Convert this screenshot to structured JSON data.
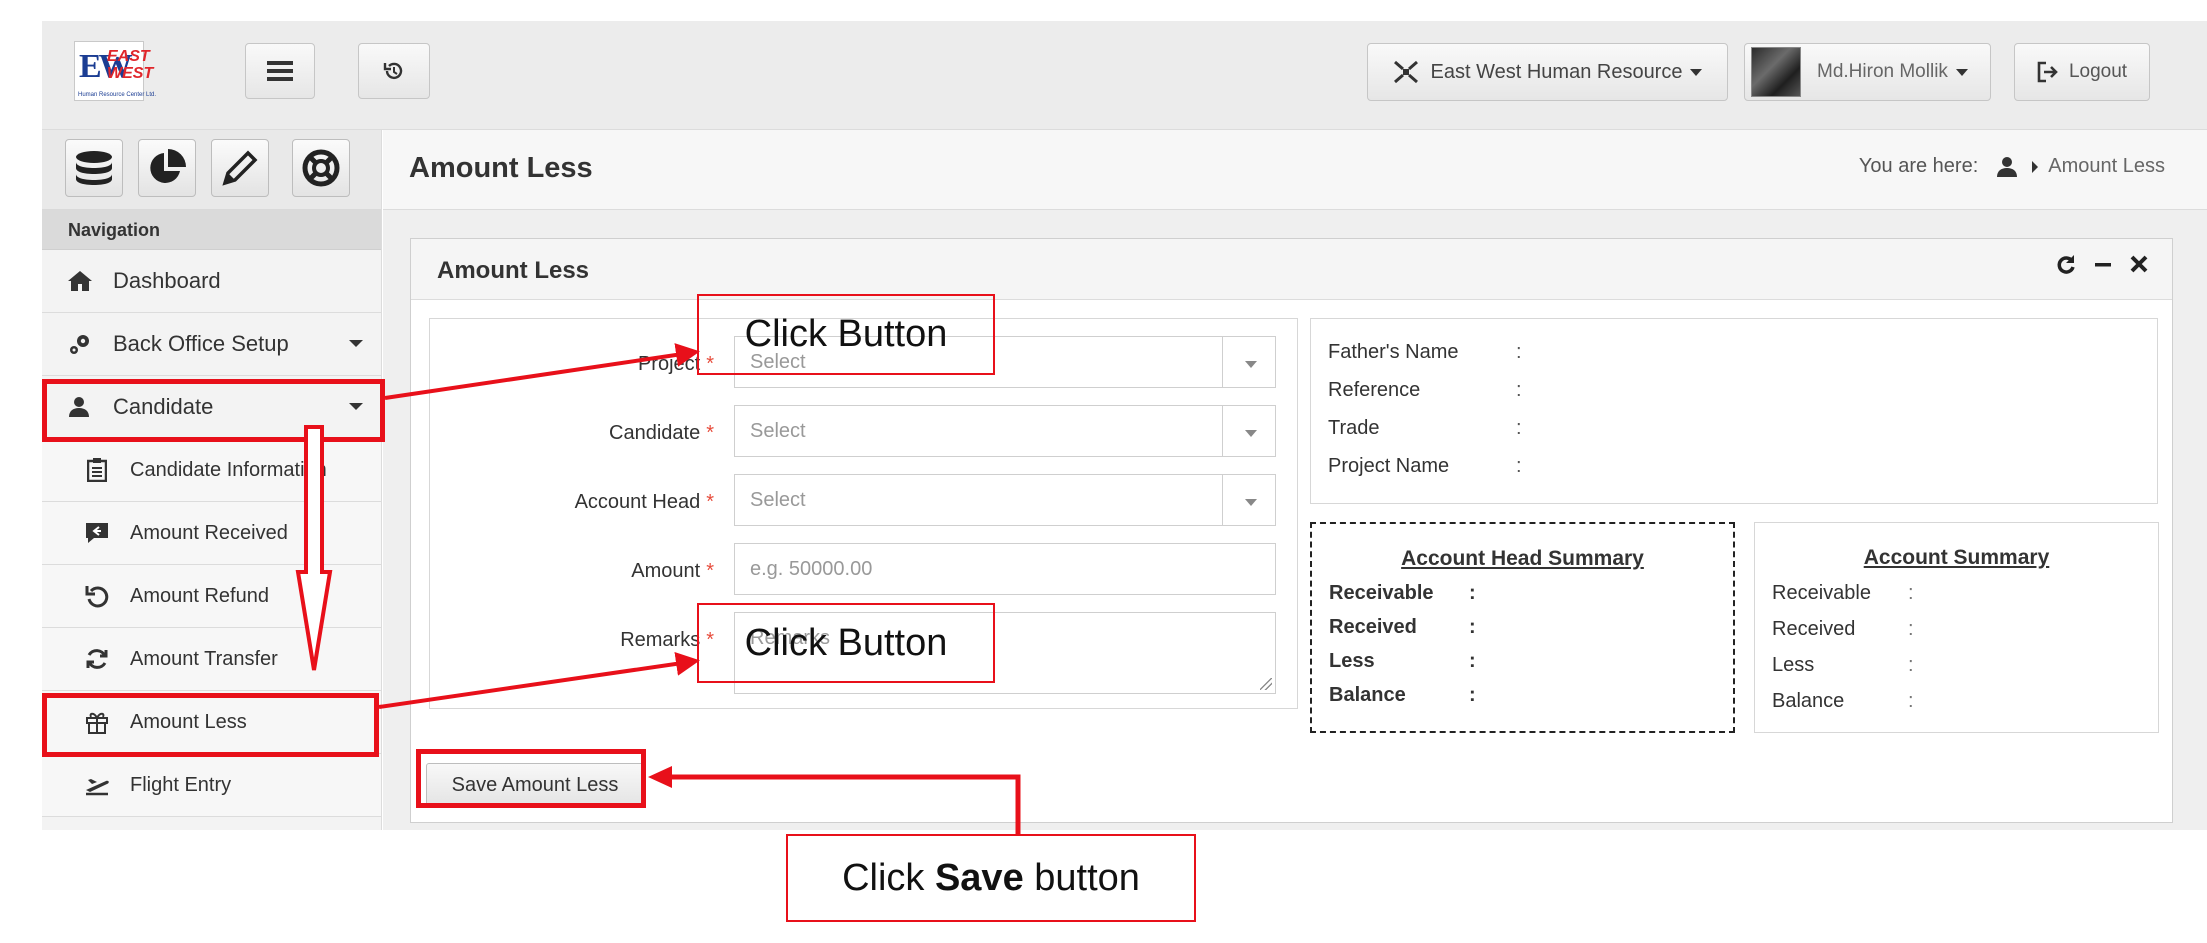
{
  "navbar": {
    "logo": {
      "letters": "EW",
      "line1": "EAST",
      "line2": "WEST",
      "subtitle": "Human Resource Center Ltd."
    },
    "company_label": "East West Human Resource",
    "user_label": "Md.Hiron Mollik",
    "logout_label": "Logout"
  },
  "sidebar": {
    "nav_header": "Navigation",
    "items": [
      {
        "label": "Dashboard",
        "icon": "home-icon"
      },
      {
        "label": "Back Office Setup",
        "icon": "cogs-icon"
      },
      {
        "label": "Candidate",
        "icon": "user-icon"
      },
      {
        "label": "Candidate Information",
        "icon": "clipboard-icon"
      },
      {
        "label": "Amount Received",
        "icon": "reply-icon"
      },
      {
        "label": "Amount Refund",
        "icon": "undo-icon"
      },
      {
        "label": "Amount Transfer",
        "icon": "refresh-icon"
      },
      {
        "label": "Amount Less",
        "icon": "gift-icon"
      },
      {
        "label": "Flight Entry",
        "icon": "plane-icon"
      }
    ]
  },
  "page": {
    "title": "Amount Less",
    "breadcrumb_prefix": "You are here:",
    "breadcrumb_current": "Amount Less"
  },
  "panel": {
    "title": "Amount Less",
    "form": {
      "project": {
        "label": "Project",
        "placeholder": "Select"
      },
      "candidate": {
        "label": "Candidate",
        "placeholder": "Select"
      },
      "account_head": {
        "label": "Account Head",
        "placeholder": "Select"
      },
      "amount": {
        "label": "Amount",
        "placeholder": "e.g. 50000.00"
      },
      "remarks": {
        "label": "Remarks",
        "placeholder": "Remarks"
      },
      "required_mark": "*"
    },
    "info": {
      "fathers_name": "Father's Name",
      "reference": "Reference",
      "trade": "Trade",
      "project_name": "Project Name",
      "colon": ":"
    },
    "account_head_summary": {
      "title": "Account Head Summary",
      "rows": [
        "Receivable",
        "Received",
        "Less",
        "Balance"
      ]
    },
    "account_summary": {
      "title": "Account Summary",
      "rows": [
        "Receivable",
        "Received",
        "Less",
        "Balance"
      ]
    },
    "save_label": "Save Amount Less"
  },
  "annotations": {
    "callout_top": "Click Button",
    "callout_mid": "Click Button",
    "callout_save_prefix": "Click ",
    "callout_save_bold": "Save",
    "callout_save_suffix": " button",
    "color": "#e8101a"
  }
}
